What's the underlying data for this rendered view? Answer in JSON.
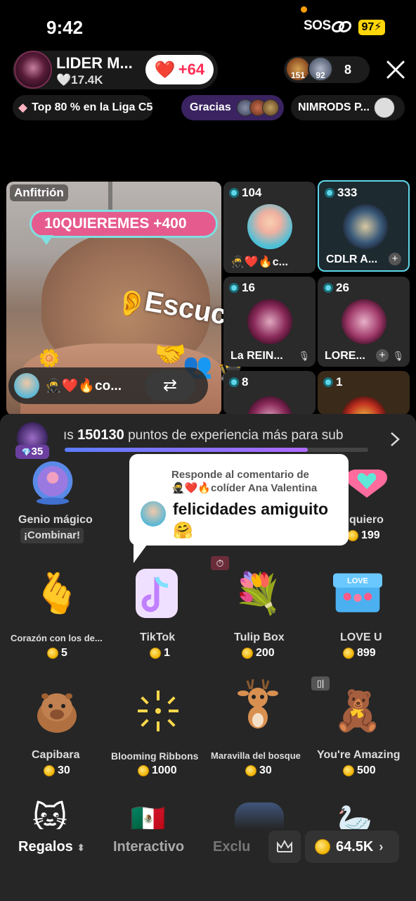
{
  "status": {
    "time": "9:42",
    "sos": "SOS",
    "battery": "97"
  },
  "host": {
    "name": "LIDER M...",
    "likes": "17.4K",
    "like_delta": "+64"
  },
  "viewers": {
    "count": "8",
    "avatar_labels": [
      "151",
      "92"
    ]
  },
  "chips": {
    "rank": "Top 80 % en la Liga C5",
    "thanks": "Gracias",
    "nimrods": "NIMRODS P..."
  },
  "host_video": {
    "label": "Anfitrión",
    "banner": "10QUIEREMES +400",
    "overlay_text": "Escucha",
    "guest_name": "co..."
  },
  "tiles": [
    {
      "score": "104",
      "name": "c..."
    },
    {
      "score": "333",
      "name": "CDLR A..."
    },
    {
      "score": "16",
      "name": "La REIN..."
    },
    {
      "score": "26",
      "name": "LORE..."
    },
    {
      "score": "8",
      "name": ""
    },
    {
      "score": "1",
      "name": ""
    }
  ],
  "xp": {
    "level": "35",
    "prefix": "ıs ",
    "points": "150130",
    "message": " puntos de experiencia más para sub",
    "progress": 0.8
  },
  "comment": {
    "header": "Responde al comentario de",
    "author": "🥷❤️🔥colíder Ana Valentina",
    "body": "felicidades amiguito 🤗"
  },
  "gifts": [
    {
      "name": "Genio mágico",
      "sub": "¡Combinar!",
      "price": ""
    },
    {
      "name": "quiero",
      "price": "199"
    },
    {
      "name": "Corazón con los de...",
      "price": "5"
    },
    {
      "name": "TikTok",
      "price": "1"
    },
    {
      "name": "Tulip Box",
      "price": "200"
    },
    {
      "name": "LOVE U",
      "price": "899"
    },
    {
      "name": "Capibara",
      "price": "30"
    },
    {
      "name": "Blooming Ribbons",
      "price": "1000"
    },
    {
      "name": "Maravilla del bosque",
      "price": "30"
    },
    {
      "name": "You're Amazing",
      "price": "500"
    }
  ],
  "tabs": {
    "regalos": "Regalos",
    "interactivo": "Interactivo",
    "exclusivo": "Exclu"
  },
  "balance": "64.5K",
  "icons": {
    "gifts": [
      "genie-icon",
      "heart-gift-icon",
      "finger-heart-icon",
      "tiktok-logo-icon",
      "tulip-box-icon",
      "love-u-box-icon",
      "capybara-icon",
      "ribbons-icon",
      "deer-icon",
      "bear-icon"
    ]
  },
  "colors": {
    "accent": "#fe2c55",
    "tile_highlight": "#5fd7e8",
    "coin": "#f0b400",
    "xp_start": "#5b7cff",
    "xp_end": "#b06bff"
  }
}
